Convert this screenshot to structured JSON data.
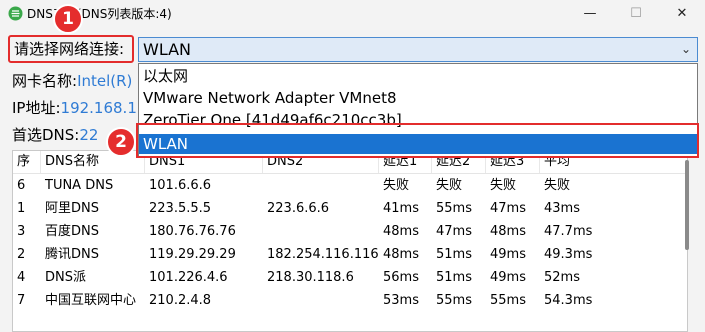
{
  "window": {
    "title": "DNS工具(DNS列表版本:4)",
    "minimize_icon": "—",
    "maximize_icon": "☐",
    "close_icon": "✕"
  },
  "connection": {
    "label": "请选择网络连接:",
    "selected": "WLAN",
    "options": [
      "以太网",
      "VMware Network Adapter VMnet8",
      "ZeroTier One [41d49af6c210cc3b]",
      "WLAN"
    ],
    "highlighted_option": "WLAN"
  },
  "info": {
    "nic_label": "网卡名称:",
    "nic_value": "Intel(R)",
    "ip_label": "IP地址:",
    "ip_value": "192.168.1",
    "dns_label": "首选DNS:",
    "dns_value": "22"
  },
  "markers": [
    "1",
    "2"
  ],
  "table": {
    "columns": [
      "序",
      "DNS名称",
      "DNS1",
      "DNS2",
      "延迟1",
      "延迟2",
      "延迟3",
      "平均"
    ],
    "rows": [
      [
        "6",
        "TUNA DNS",
        "101.6.6.6",
        "",
        "失败",
        "失败",
        "失败",
        "失败"
      ],
      [
        "1",
        "阿里DNS",
        "223.5.5.5",
        "223.6.6.6",
        "41ms",
        "55ms",
        "47ms",
        "43ms"
      ],
      [
        "3",
        "百度DNS",
        "180.76.76.76",
        "",
        "48ms",
        "47ms",
        "48ms",
        "47.7ms"
      ],
      [
        "2",
        "腾讯DNS",
        "119.29.29.29",
        "182.254.116.116",
        "48ms",
        "51ms",
        "49ms",
        "49.3ms"
      ],
      [
        "4",
        "DNS派",
        "101.226.4.6",
        "218.30.118.6",
        "56ms",
        "51ms",
        "49ms",
        "52ms"
      ],
      [
        "7",
        "中国互联网中心",
        "210.2.4.8",
        "",
        "53ms",
        "55ms",
        "55ms",
        "54.3ms"
      ]
    ]
  },
  "colors": {
    "accent": "#1a73d1",
    "highlight_red": "#e32c2c",
    "link_blue": "#2f7bd4"
  }
}
